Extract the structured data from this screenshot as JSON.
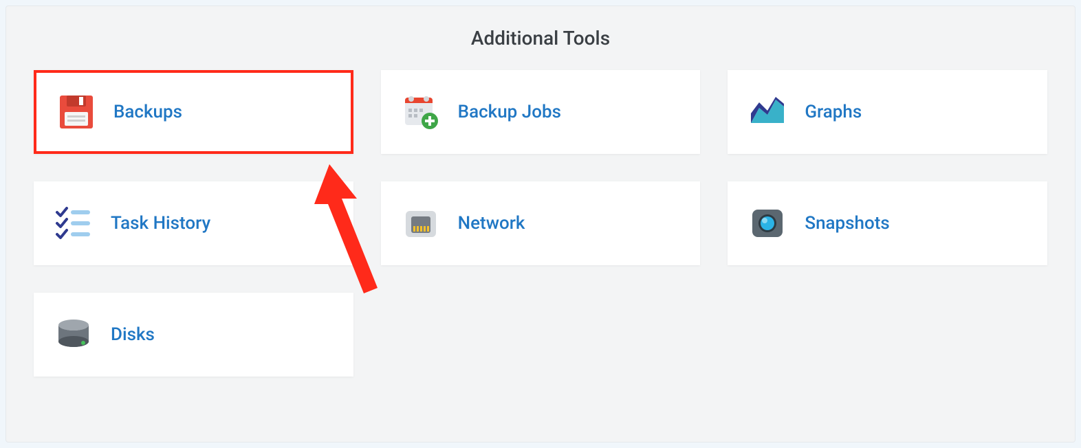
{
  "title": "Additional Tools",
  "cards": {
    "backups": {
      "label": "Backups"
    },
    "backup_jobs": {
      "label": "Backup Jobs"
    },
    "graphs": {
      "label": "Graphs"
    },
    "task_history": {
      "label": "Task History"
    },
    "network": {
      "label": "Network"
    },
    "snapshots": {
      "label": "Snapshots"
    },
    "disks": {
      "label": "Disks"
    }
  },
  "highlight": "backups"
}
